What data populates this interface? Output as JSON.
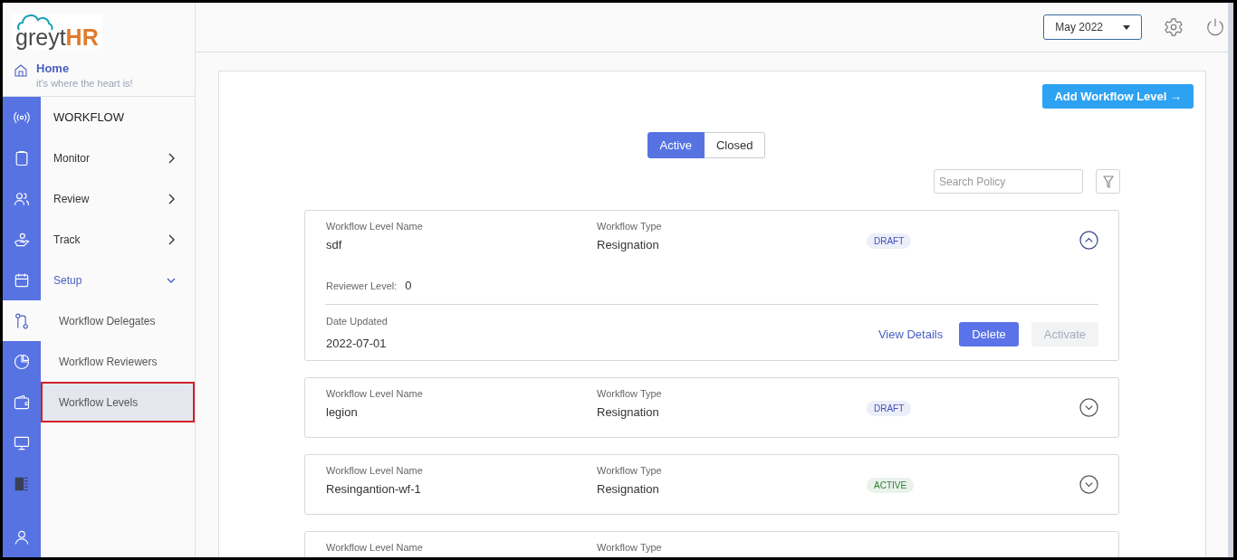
{
  "logo": {
    "text_main": "greyt",
    "text_accent": "HR"
  },
  "home": {
    "title": "Home",
    "subtitle": "it's where the heart is!"
  },
  "rail": [
    {
      "selected": false
    },
    {
      "selected": false
    },
    {
      "selected": false
    },
    {
      "selected": false
    },
    {
      "selected": false
    },
    {
      "selected": true
    },
    {
      "selected": false
    },
    {
      "selected": false
    },
    {
      "selected": false
    },
    {
      "selected": false
    },
    {
      "selected": false
    }
  ],
  "menu": {
    "title": "WORKFLOW",
    "items": [
      {
        "label": "Monitor",
        "expanded": false
      },
      {
        "label": "Review",
        "expanded": false
      },
      {
        "label": "Track",
        "expanded": false
      },
      {
        "label": "Setup",
        "expanded": true,
        "children": [
          {
            "label": "Workflow Delegates",
            "selected": false
          },
          {
            "label": "Workflow Reviewers",
            "selected": false
          },
          {
            "label": "Workflow Levels",
            "selected": true
          }
        ]
      }
    ]
  },
  "header": {
    "period": "May 2022"
  },
  "add_button": "Add Workflow Level →",
  "tabs": [
    {
      "label": "Active",
      "selected": true
    },
    {
      "label": "Closed",
      "selected": false
    }
  ],
  "search": {
    "placeholder": "Search Policy"
  },
  "cards": [
    {
      "name_label": "Workflow Level Name",
      "name": "sdf",
      "type_label": "Workflow Type",
      "type": "Resignation",
      "status": "DRAFT",
      "color": "#3f51b5",
      "expanded": true,
      "reviewer_label": "Reviewer Level:",
      "reviewer_level": "0",
      "date_label": "Date Updated",
      "date": "2022-07-01",
      "actions": [
        {
          "label": "View Details",
          "kind": "link",
          "disabled": false
        },
        {
          "label": "Delete",
          "kind": "primary",
          "disabled": false
        },
        {
          "label": "Activate",
          "kind": "primary",
          "disabled": true
        }
      ]
    },
    {
      "name_label": "Workflow Level Name",
      "name": "legion",
      "type_label": "Workflow Type",
      "type": "Resignation",
      "status": "DRAFT",
      "color": "#3f51b5",
      "expanded": false
    },
    {
      "name_label": "Workflow Level Name",
      "name": "Resingantion-wf-1",
      "type_label": "Workflow Type",
      "type": "Resignation",
      "status": "ACTIVE",
      "color": "#2e7d32",
      "expanded": false
    },
    {
      "name_label": "Workflow Level Name",
      "type_label": "Workflow Type"
    }
  ]
}
